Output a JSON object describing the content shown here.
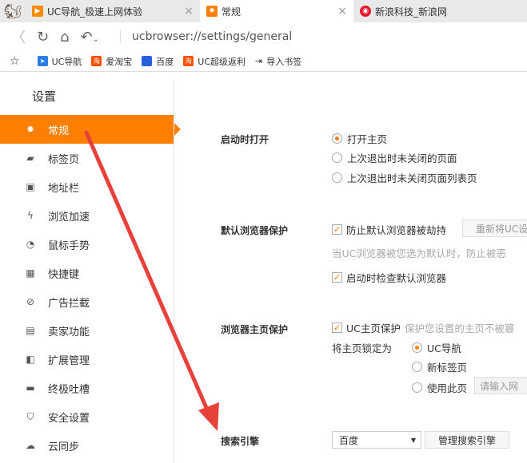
{
  "tabs": [
    {
      "label": "UC导航_极速上网体验",
      "close": "×"
    },
    {
      "label": "常规",
      "close": "×"
    },
    {
      "label": "新浪科技_新浪网"
    }
  ],
  "address": "ucbrowser://settings/general",
  "bookmarks": [
    "UC导航",
    "爱淘宝",
    "百度",
    "UC超级返利",
    "导入书签"
  ],
  "sidebar": {
    "title": "设置",
    "items": [
      "常规",
      "标签页",
      "地址栏",
      "浏览加速",
      "鼠标手势",
      "快捷键",
      "广告拦截",
      "卖家功能",
      "扩展管理",
      "终极吐槽",
      "安全设置",
      "云同步"
    ]
  },
  "startup": {
    "label": "启动时打开",
    "options": [
      "打开主页",
      "上次退出时未关闭的页面",
      "上次退出时未关闭页面列表页"
    ]
  },
  "default_protect": {
    "label": "默认浏览器保护",
    "prevent": "防止默认浏览器被劫持",
    "reset_button": "重新将UC设",
    "hint": "当UC浏览器被您选为默认时，防止被恶",
    "check_startup": "启动时检查默认浏览器"
  },
  "home_protect": {
    "label": "浏览器主页保护",
    "uc_protect": "UC主页保护",
    "hint": "保护您设置的主页不被篡",
    "lock_label": "将主页锁定为",
    "options": [
      "UC导航",
      "新标签页",
      "使用此页"
    ],
    "url_placeholder": "请输入网"
  },
  "search": {
    "label": "搜索引擎",
    "selected": "百度",
    "manage_button": "管理搜索引擎"
  },
  "colors": {
    "accent": "#ff7f00",
    "arrow": "#e8413c"
  }
}
